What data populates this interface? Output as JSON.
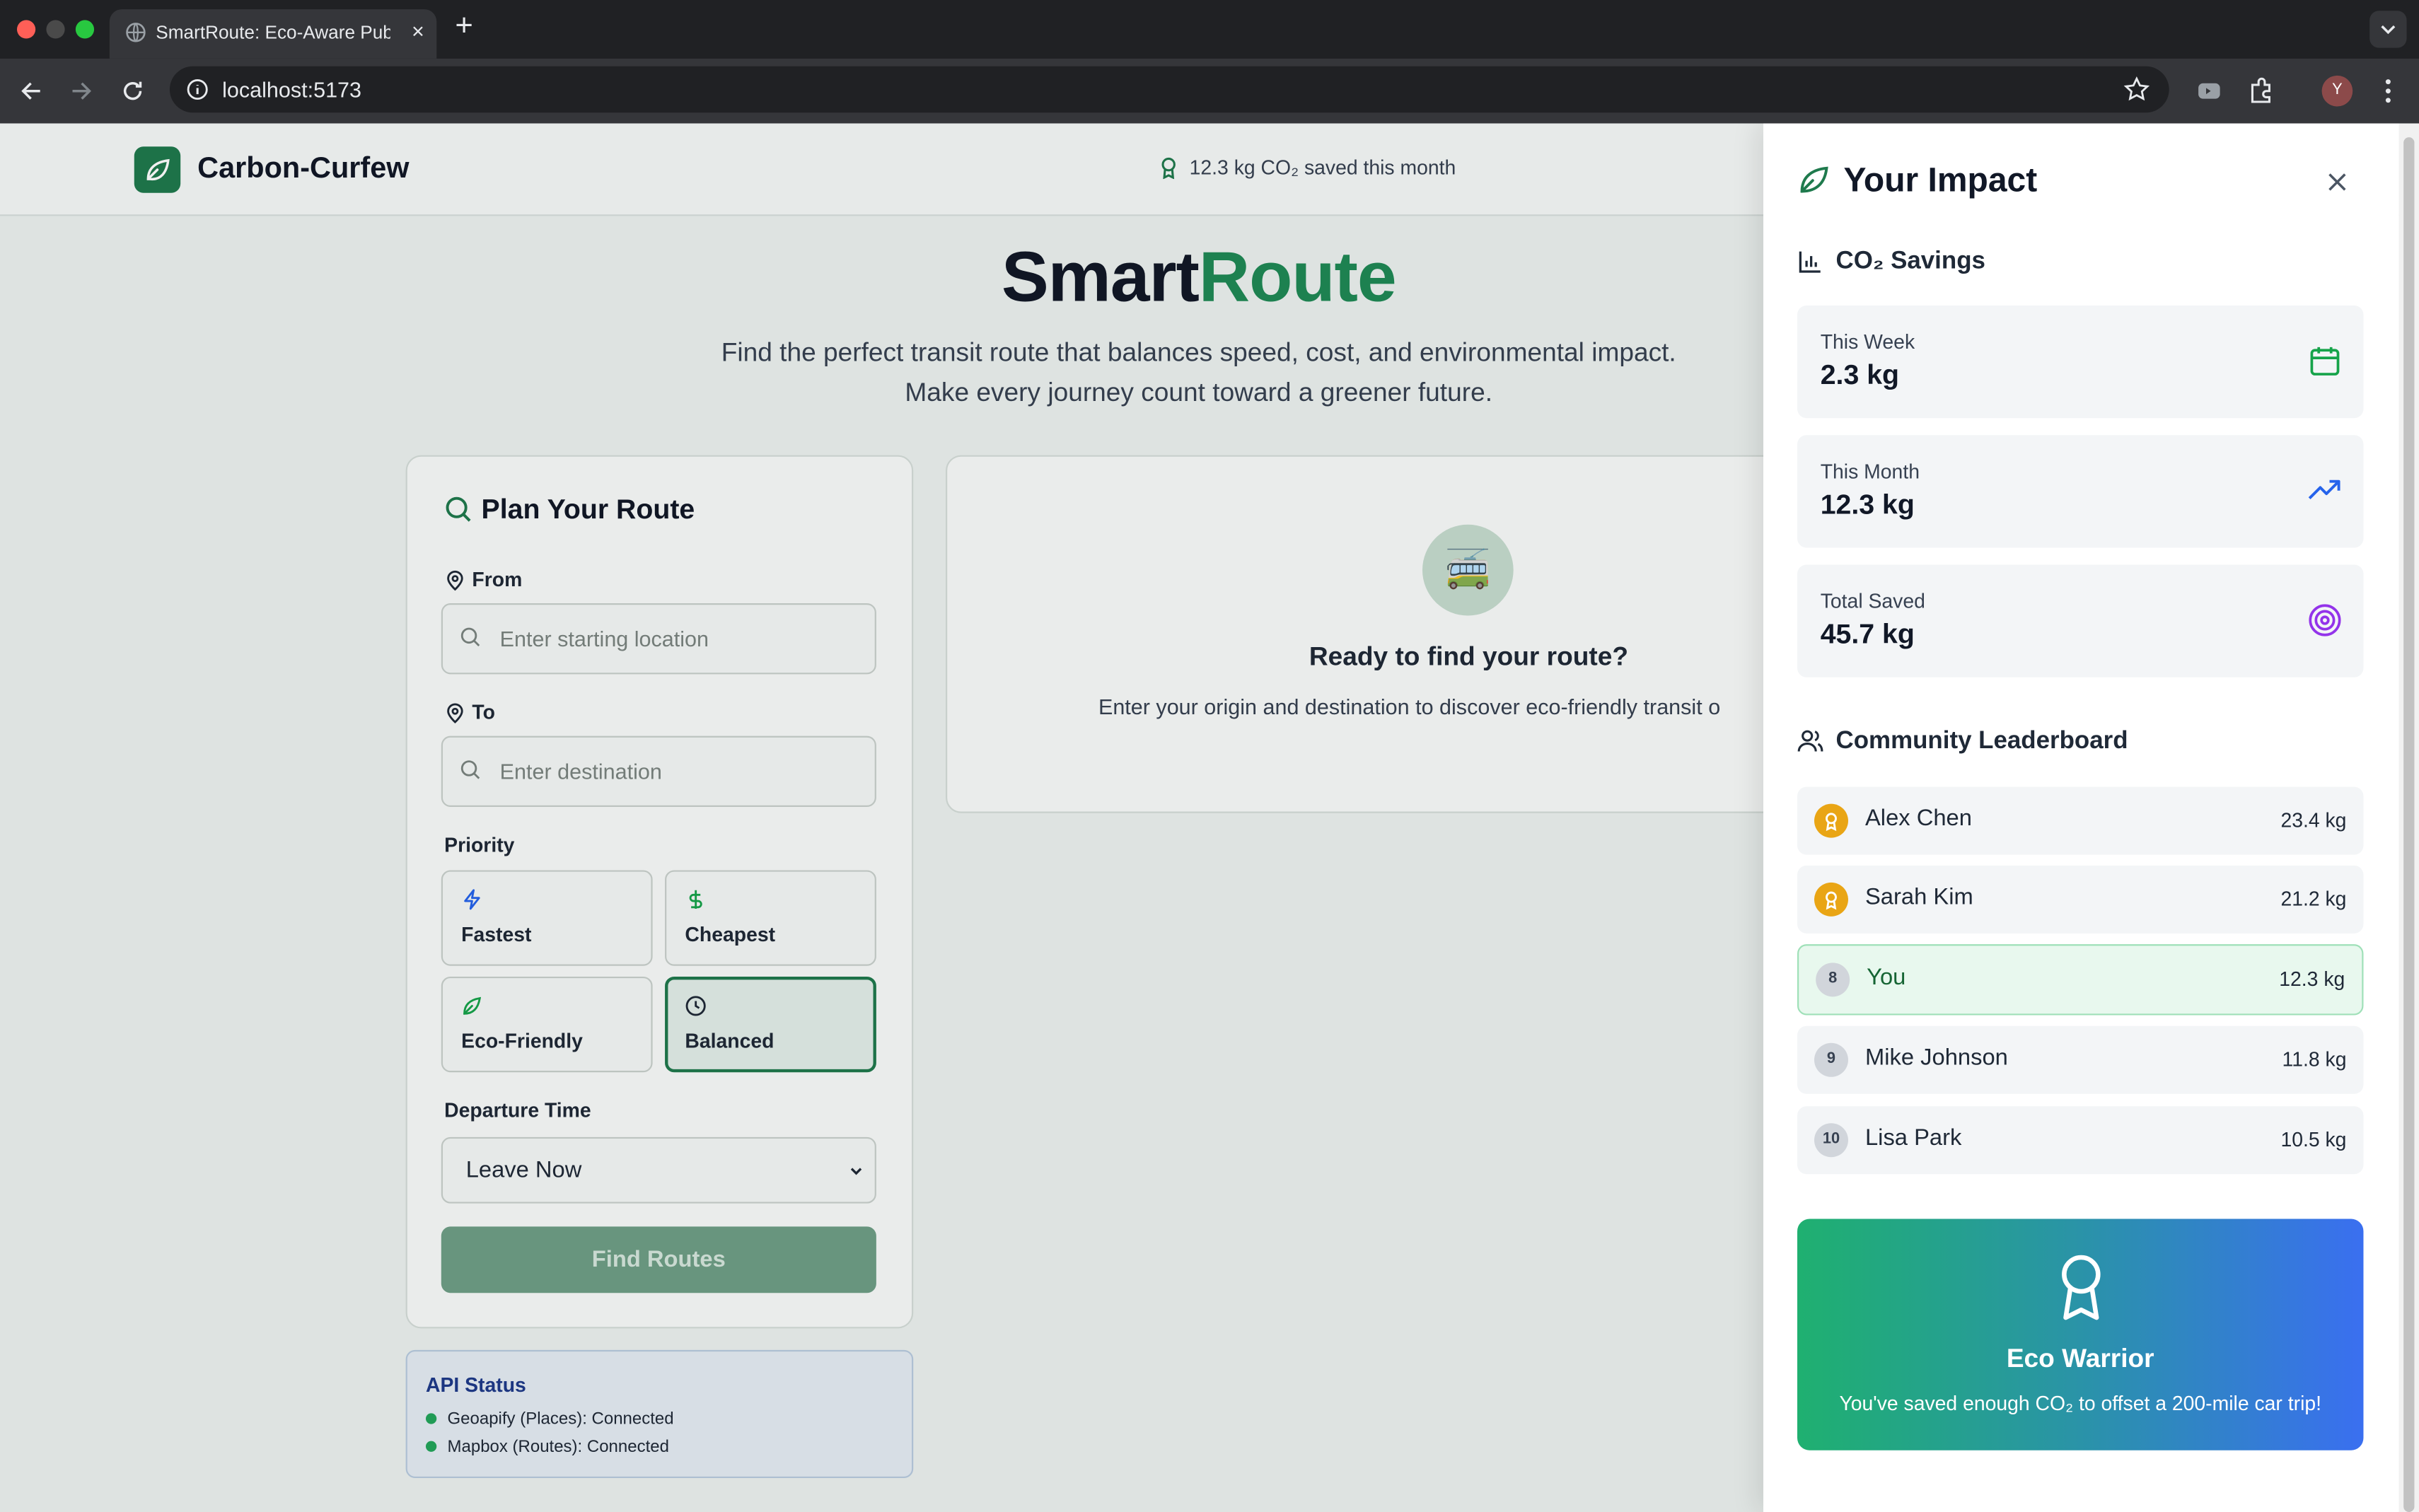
{
  "browser": {
    "tab_title": "SmartRoute: Eco-Aware Publi",
    "url": "localhost:5173",
    "profile_initial": "Y"
  },
  "header": {
    "brand": "Carbon-Curfew",
    "saved_text": "12.3 kg CO₂ saved this month"
  },
  "hero": {
    "title_part1": "Smart",
    "title_part2": "Route",
    "subtitle_line1": "Find the perfect transit route that balances speed, cost, and environmental impact.",
    "subtitle_line2": "Make every journey count toward a greener future."
  },
  "planner": {
    "title": "Plan Your Route",
    "from_label": "From",
    "from_placeholder": "Enter starting location",
    "to_label": "To",
    "to_placeholder": "Enter destination",
    "priority_label": "Priority",
    "priorities": [
      {
        "label": "Fastest",
        "icon": "zap-icon"
      },
      {
        "label": "Cheapest",
        "icon": "dollar-icon"
      },
      {
        "label": "Eco-Friendly",
        "icon": "leaf-icon"
      },
      {
        "label": "Balanced",
        "icon": "clock-icon",
        "selected": true
      }
    ],
    "departure_label": "Departure Time",
    "departure_value": "Leave Now",
    "find_button": "Find Routes"
  },
  "api_status": {
    "title": "API Status",
    "items": [
      "Geoapify (Places): Connected",
      "Mapbox (Routes): Connected"
    ]
  },
  "ready": {
    "icon": "🚎",
    "title": "Ready to find your route?",
    "subtitle": "Enter your origin and destination to discover eco-friendly transit o"
  },
  "impact_panel": {
    "title": "Your Impact",
    "savings_title": "CO₂ Savings",
    "stats": [
      {
        "label": "This Week",
        "value": "2.3 kg",
        "icon": "calendar-icon",
        "color": "#16a34a"
      },
      {
        "label": "This Month",
        "value": "12.3 kg",
        "icon": "trending-up-icon",
        "color": "#2563eb"
      },
      {
        "label": "Total Saved",
        "value": "45.7 kg",
        "icon": "target-icon",
        "color": "#9333ea"
      }
    ],
    "leaderboard_title": "Community Leaderboard",
    "leaderboard": [
      {
        "rank": "",
        "name": "Alex Chen",
        "value": "23.4 kg"
      },
      {
        "rank": "",
        "name": "Sarah Kim",
        "value": "21.2 kg"
      },
      {
        "rank": "8",
        "name": "You",
        "value": "12.3 kg"
      },
      {
        "rank": "9",
        "name": "Mike Johnson",
        "value": "11.8 kg"
      },
      {
        "rank": "10",
        "name": "Lisa Park",
        "value": "10.5 kg"
      }
    ],
    "badge": {
      "title": "Eco Warrior",
      "subtitle": "You've saved enough CO₂ to offset a 200-mile car trip!"
    }
  },
  "colors": {
    "brand_green": "#1f7a4d",
    "accent_green": "#1f8a55",
    "gold": "#e9a515"
  }
}
